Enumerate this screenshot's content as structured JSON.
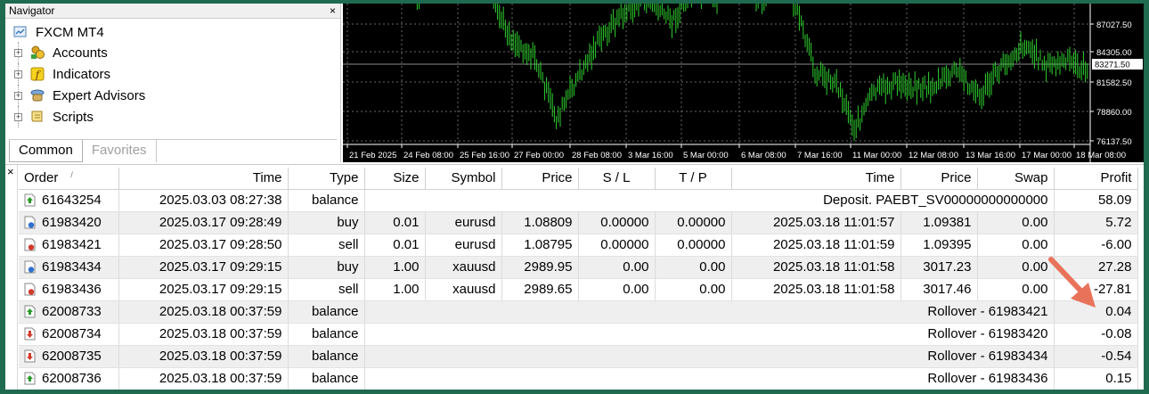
{
  "navigator": {
    "title": "Navigator",
    "close": "×",
    "root": "FXCM MT4",
    "items": [
      {
        "label": "Accounts",
        "icon": "accounts-icon"
      },
      {
        "label": "Indicators",
        "icon": "indicators-icon"
      },
      {
        "label": "Expert Advisors",
        "icon": "expert-advisors-icon"
      },
      {
        "label": "Scripts",
        "icon": "scripts-icon"
      }
    ],
    "tabs": [
      "Common",
      "Favorites"
    ]
  },
  "chart": {
    "price_labels": [
      "87027.50",
      "84305.00",
      "83271.50",
      "81582.50",
      "78860.00",
      "76137.50"
    ],
    "current_price": "83271.50",
    "time_labels": [
      "21 Feb 2025",
      "24 Feb 08:00",
      "25 Feb 16:00",
      "27 Feb 00:00",
      "28 Feb 08:00",
      "3 Mar 16:00",
      "5 Mar 00:00",
      "6 Mar 08:00",
      "7 Mar 16:00",
      "11 Mar 00:00",
      "12 Mar 08:00",
      "13 Mar 16:00",
      "17 Mar 00:00",
      "18 Mar 08:00"
    ],
    "candle_color": "#2fd12f"
  },
  "terminal": {
    "close": "×",
    "columns": [
      "Order",
      "Time",
      "Type",
      "Size",
      "Symbol",
      "Price",
      "S / L",
      "T / P",
      "Time",
      "Price",
      "Swap",
      "Profit"
    ],
    "sort_mark": "/",
    "rows": [
      {
        "order": "61643254",
        "icon": "balance-up-icon",
        "time": "2025.03.03 08:27:38",
        "type": "balance",
        "comment": "Deposit. PAEBT_SV00000000000000",
        "profit": "58.09"
      },
      {
        "order": "61983420",
        "icon": "buy-icon",
        "time": "2025.03.17 09:28:49",
        "type": "buy",
        "size": "0.01",
        "symbol": "eurusd",
        "price": "1.08809",
        "sl": "0.00000",
        "tp": "0.00000",
        "close_time": "2025.03.18 11:01:57",
        "close_price": "1.09381",
        "swap": "0.00",
        "profit": "5.72"
      },
      {
        "order": "61983421",
        "icon": "sell-icon",
        "time": "2025.03.17 09:28:50",
        "type": "sell",
        "size": "0.01",
        "symbol": "eurusd",
        "price": "1.08795",
        "sl": "0.00000",
        "tp": "0.00000",
        "close_time": "2025.03.18 11:01:59",
        "close_price": "1.09395",
        "swap": "0.00",
        "profit": "-6.00"
      },
      {
        "order": "61983434",
        "icon": "buy-icon",
        "time": "2025.03.17 09:29:15",
        "type": "buy",
        "size": "1.00",
        "symbol": "xauusd",
        "price": "2989.95",
        "sl": "0.00",
        "tp": "0.00",
        "close_time": "2025.03.18 11:01:58",
        "close_price": "3017.23",
        "swap": "0.00",
        "profit": "27.28"
      },
      {
        "order": "61983436",
        "icon": "sell-icon",
        "time": "2025.03.17 09:29:15",
        "type": "sell",
        "size": "1.00",
        "symbol": "xauusd",
        "price": "2989.65",
        "sl": "0.00",
        "tp": "0.00",
        "close_time": "2025.03.18 11:01:58",
        "close_price": "3017.46",
        "swap": "0.00",
        "profit": "-27.81"
      },
      {
        "order": "62008733",
        "icon": "balance-up-icon",
        "time": "2025.03.18 00:37:59",
        "type": "balance",
        "comment": "Rollover - 61983421",
        "profit": "0.04"
      },
      {
        "order": "62008734",
        "icon": "balance-down-icon",
        "time": "2025.03.18 00:37:59",
        "type": "balance",
        "comment": "Rollover - 61983420",
        "profit": "-0.08"
      },
      {
        "order": "62008735",
        "icon": "balance-down-icon",
        "time": "2025.03.18 00:37:59",
        "type": "balance",
        "comment": "Rollover - 61983434",
        "profit": "-0.54"
      },
      {
        "order": "62008736",
        "icon": "balance-up-icon",
        "time": "2025.03.18 00:37:59",
        "type": "balance",
        "comment": "Rollover - 61983436",
        "profit": "0.15"
      }
    ]
  },
  "annotation": {
    "arrow_color": "#e8735a"
  }
}
